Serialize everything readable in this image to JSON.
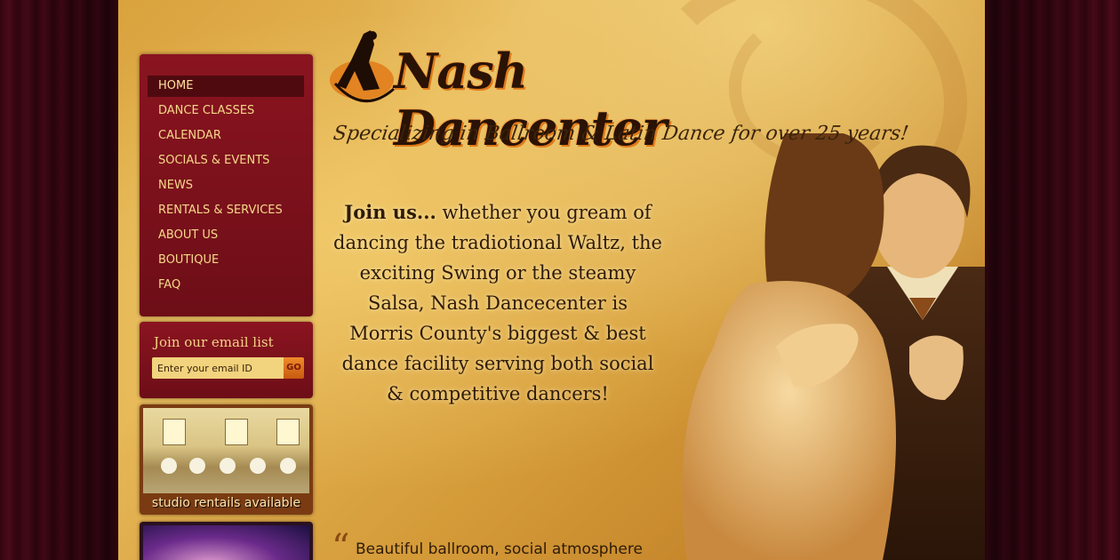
{
  "nav": {
    "items": [
      {
        "label": "HOME",
        "active": true
      },
      {
        "label": "DANCE CLASSES"
      },
      {
        "label": "CALENDAR"
      },
      {
        "label": "SOCIALS & EVENTS"
      },
      {
        "label": "NEWS"
      },
      {
        "label": "RENTALS & SERVICES"
      },
      {
        "label": "ABOUT US"
      },
      {
        "label": "BOUTIQUE"
      },
      {
        "label": "FAQ"
      }
    ]
  },
  "email": {
    "title": "Join our email list",
    "placeholder": "Enter your email ID",
    "go_label": "GO"
  },
  "promos": {
    "studio_caption": "studio rentails available"
  },
  "header": {
    "logo_text": "Nash Dancenter",
    "tagline": "Specializing in Ballroom & Latin Dance for over 25 years!"
  },
  "intro": {
    "lead": "Join us...",
    "body": "whether you gream of dancing the tradiotional Waltz, the exciting Swing or the steamy Salsa, Nash Dancecenter is Morris County's biggest & best dance facility serving both social & competitive dancers!"
  },
  "quote": {
    "text": "Beautiful ballroom, social atmosphere"
  },
  "colors": {
    "nav_bg": "#7a111b",
    "nav_text": "#f6d98a",
    "accent": "#e07a18",
    "parchment": "#e6b757"
  }
}
